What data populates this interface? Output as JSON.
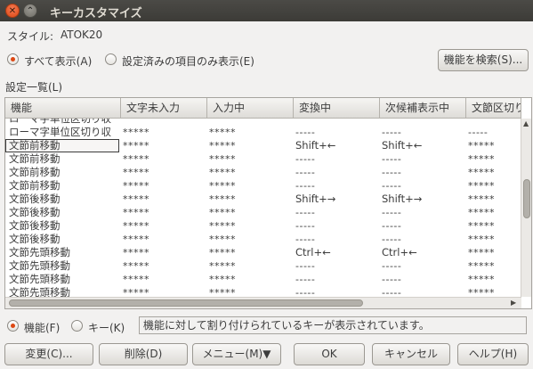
{
  "window": {
    "title": "キーカスタマイズ",
    "close_glyph": "✕",
    "minimize_glyph": "⌃"
  },
  "style_label": "スタイル:",
  "style_value": "ATOK20",
  "filter": {
    "show_all_label": "すべて表示(A)",
    "show_set_only_label": "設定済みの項目のみ表示(E)",
    "selected": "show_all"
  },
  "search_button": "機能を検索(S)...",
  "list_label": "設定一覧(L)",
  "table": {
    "columns": [
      "機能",
      "文字未入力",
      "入力中",
      "変換中",
      "次候補表示中",
      "文節区切り"
    ],
    "rows": [
      [
        "ローマ字単位区切り収",
        "",
        "",
        "",
        "",
        ""
      ],
      [
        "ローマ字単位区切り収",
        "*****",
        "*****",
        "-----",
        "-----",
        "-----"
      ],
      [
        "文節前移動",
        "*****",
        "*****",
        "Shift+←",
        "Shift+←",
        "*****"
      ],
      [
        "文節前移動",
        "*****",
        "*****",
        "-----",
        "-----",
        "*****"
      ],
      [
        "文節前移動",
        "*****",
        "*****",
        "-----",
        "-----",
        "*****"
      ],
      [
        "文節前移動",
        "*****",
        "*****",
        "-----",
        "-----",
        "*****"
      ],
      [
        "文節後移動",
        "*****",
        "*****",
        "Shift+→",
        "Shift+→",
        "*****"
      ],
      [
        "文節後移動",
        "*****",
        "*****",
        "-----",
        "-----",
        "*****"
      ],
      [
        "文節後移動",
        "*****",
        "*****",
        "-----",
        "-----",
        "*****"
      ],
      [
        "文節後移動",
        "*****",
        "*****",
        "-----",
        "-----",
        "*****"
      ],
      [
        "文節先頭移動",
        "*****",
        "*****",
        "Ctrl+←",
        "Ctrl+←",
        "*****"
      ],
      [
        "文節先頭移動",
        "*****",
        "*****",
        "-----",
        "-----",
        "*****"
      ],
      [
        "文節先頭移動",
        "*****",
        "*****",
        "-----",
        "-----",
        "*****"
      ],
      [
        "文節先頭移動",
        "*****",
        "*****",
        "-----",
        "-----",
        "*****"
      ]
    ],
    "selected_row": 2
  },
  "mode": {
    "function_label": "機能(F)",
    "key_label": "キー(K)",
    "selected": "function",
    "status_text": "機能に対して割り付けられているキーが表示されています。"
  },
  "buttons": {
    "change": "変更(C)...",
    "delete": "削除(D)",
    "menu": "メニュー(M)▼",
    "ok": "OK",
    "cancel": "キャンセル",
    "help": "ヘルプ(H)"
  }
}
